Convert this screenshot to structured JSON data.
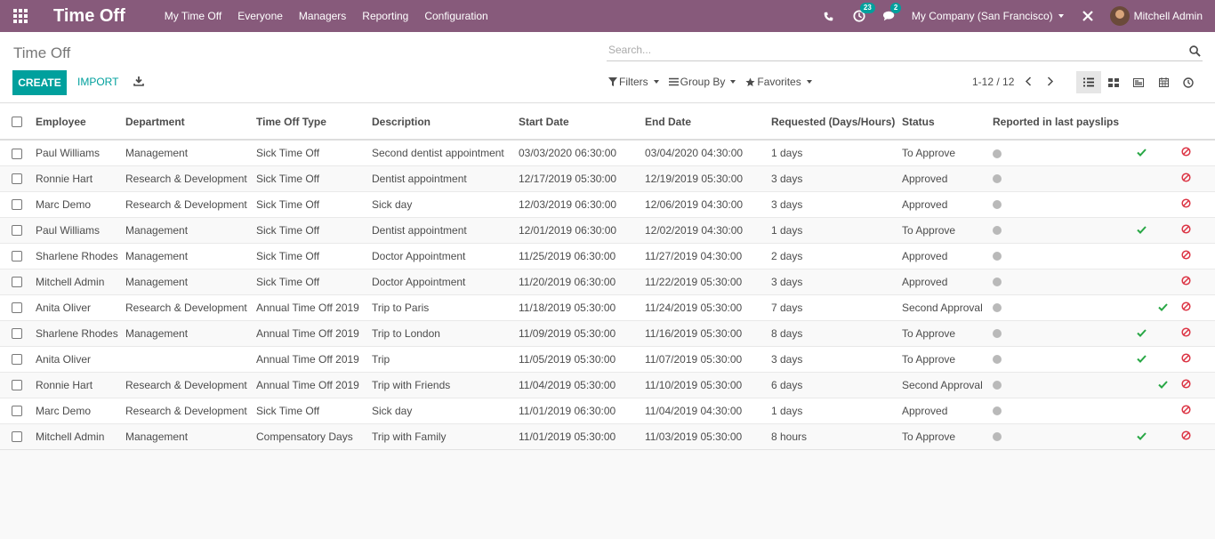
{
  "app": {
    "title": "Time Off",
    "menu": [
      "My Time Off",
      "Everyone",
      "Managers",
      "Reporting",
      "Configuration"
    ],
    "activity_count": "23",
    "message_count": "2",
    "company": "My Company (San Francisco)",
    "user": "Mitchell Admin"
  },
  "control": {
    "breadcrumb": "Time Off",
    "search_placeholder": "Search...",
    "create_label": "CREATE",
    "import_label": "IMPORT",
    "filters_label": "Filters",
    "groupby_label": "Group By",
    "favorites_label": "Favorites",
    "pager": "1-12 / 12"
  },
  "table": {
    "headers": [
      "Employee",
      "Department",
      "Time Off Type",
      "Description",
      "Start Date",
      "End Date",
      "Requested (Days/Hours)",
      "Status",
      "Reported in last payslips"
    ],
    "rows": [
      {
        "employee": "Paul Williams",
        "department": "Management",
        "type": "Sick Time Off",
        "description": "Second dentist appointment",
        "start": "03/03/2020 06:30:00",
        "end": "03/04/2020 04:30:00",
        "requested": "1 days",
        "status": "To Approve",
        "approve": true,
        "second": false
      },
      {
        "employee": "Ronnie Hart",
        "department": "Research & Development",
        "type": "Sick Time Off",
        "description": "Dentist appointment",
        "start": "12/17/2019 05:30:00",
        "end": "12/19/2019 05:30:00",
        "requested": "3 days",
        "status": "Approved",
        "approve": false,
        "second": false
      },
      {
        "employee": "Marc Demo",
        "department": "Research & Development",
        "type": "Sick Time Off",
        "description": "Sick day",
        "start": "12/03/2019 06:30:00",
        "end": "12/06/2019 04:30:00",
        "requested": "3 days",
        "status": "Approved",
        "approve": false,
        "second": false
      },
      {
        "employee": "Paul Williams",
        "department": "Management",
        "type": "Sick Time Off",
        "description": "Dentist appointment",
        "start": "12/01/2019 06:30:00",
        "end": "12/02/2019 04:30:00",
        "requested": "1 days",
        "status": "To Approve",
        "approve": true,
        "second": false
      },
      {
        "employee": "Sharlene Rhodes",
        "department": "Management",
        "type": "Sick Time Off",
        "description": "Doctor Appointment",
        "start": "11/25/2019 06:30:00",
        "end": "11/27/2019 04:30:00",
        "requested": "2 days",
        "status": "Approved",
        "approve": false,
        "second": false
      },
      {
        "employee": "Mitchell Admin",
        "department": "Management",
        "type": "Sick Time Off",
        "description": "Doctor Appointment",
        "start": "11/20/2019 06:30:00",
        "end": "11/22/2019 05:30:00",
        "requested": "3 days",
        "status": "Approved",
        "approve": false,
        "second": false
      },
      {
        "employee": "Anita Oliver",
        "department": "Research & Development",
        "type": "Annual Time Off 2019",
        "description": "Trip to Paris",
        "start": "11/18/2019 05:30:00",
        "end": "11/24/2019 05:30:00",
        "requested": "7 days",
        "status": "Second Approval",
        "approve": true,
        "second": true
      },
      {
        "employee": "Sharlene Rhodes",
        "department": "Management",
        "type": "Annual Time Off 2019",
        "description": "Trip to London",
        "start": "11/09/2019 05:30:00",
        "end": "11/16/2019 05:30:00",
        "requested": "8 days",
        "status": "To Approve",
        "approve": true,
        "second": false
      },
      {
        "employee": "Anita Oliver",
        "department": "",
        "type": "Annual Time Off 2019",
        "description": "Trip",
        "start": "11/05/2019 05:30:00",
        "end": "11/07/2019 05:30:00",
        "requested": "3 days",
        "status": "To Approve",
        "approve": true,
        "second": false
      },
      {
        "employee": "Ronnie Hart",
        "department": "Research & Development",
        "type": "Annual Time Off 2019",
        "description": "Trip with Friends",
        "start": "11/04/2019 05:30:00",
        "end": "11/10/2019 05:30:00",
        "requested": "6 days",
        "status": "Second Approval",
        "approve": true,
        "second": true
      },
      {
        "employee": "Marc Demo",
        "department": "Research & Development",
        "type": "Sick Time Off",
        "description": "Sick day",
        "start": "11/01/2019 06:30:00",
        "end": "11/04/2019 04:30:00",
        "requested": "1 days",
        "status": "Approved",
        "approve": false,
        "second": false
      },
      {
        "employee": "Mitchell Admin",
        "department": "Management",
        "type": "Compensatory Days",
        "description": "Trip with Family",
        "start": "11/01/2019 05:30:00",
        "end": "11/03/2019 05:30:00",
        "requested": "8 hours",
        "status": "To Approve",
        "approve": true,
        "second": false
      }
    ]
  },
  "colors": {
    "navbar": "#875a7b",
    "primary": "#00a09d",
    "approve_check": "#28a745",
    "refuse": "#dc3545",
    "dot": "#b9b9b9"
  },
  "icons": {
    "apps": "apps-grid-icon",
    "phone": "phone-icon",
    "activity": "clock-activity-icon",
    "messages": "chat-icon",
    "close": "close-icon",
    "search": "search-icon",
    "download": "download-icon",
    "filter": "filter-icon",
    "groupby": "list-icon",
    "favorites": "star-icon",
    "prev": "chevron-left-icon",
    "next": "chevron-right-icon",
    "approve": "check-icon",
    "refuse": "refuse-icon"
  }
}
